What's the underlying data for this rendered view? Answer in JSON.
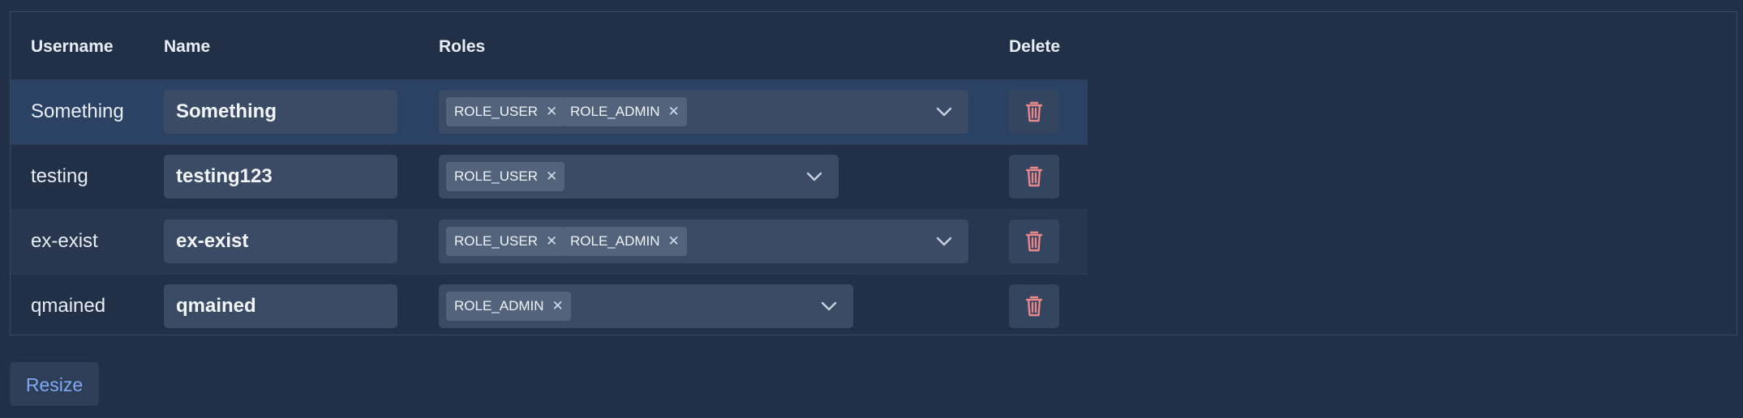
{
  "table": {
    "headers": {
      "username": "Username",
      "name": "Name",
      "roles": "Roles",
      "delete": "Delete"
    },
    "rows": [
      {
        "username": "Something",
        "name": "Something",
        "roles": [
          "ROLE_USER",
          "ROLE_ADMIN"
        ]
      },
      {
        "username": "testing",
        "name": "testing123",
        "roles": [
          "ROLE_USER"
        ]
      },
      {
        "username": "ex-exist",
        "name": "ex-exist",
        "roles": [
          "ROLE_USER",
          "ROLE_ADMIN"
        ]
      },
      {
        "username": "qmained",
        "name": "qmained",
        "roles": [
          "ROLE_ADMIN"
        ]
      }
    ],
    "remove_glyph": "✕",
    "icons": {
      "dropdown": "chevron-down-icon",
      "delete": "trash-icon"
    }
  },
  "footer": {
    "resize_label": "Resize"
  },
  "colors": {
    "background": "#223047",
    "input": "#3b4b66",
    "tag": "#53637c",
    "trash": "#e8888a",
    "accent": "#7fa9f0"
  }
}
